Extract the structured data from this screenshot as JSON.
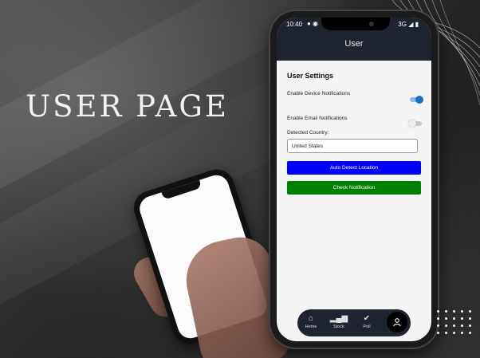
{
  "banner": {
    "headline": "USER PAGE"
  },
  "status_bar": {
    "time": "10:40",
    "network": "3G"
  },
  "app_bar": {
    "title": "User"
  },
  "settings": {
    "section_title": "User Settings",
    "device_notifications": {
      "label": "Enable Device Notifications",
      "enabled": true
    },
    "email_notifications": {
      "label": "Enable Email Notifications",
      "enabled": false
    },
    "country_label": "Detected Country:",
    "country_value": "United States"
  },
  "buttons": {
    "auto_detect_label": "Auto Detect Location",
    "check_notification_label": "Check Notification"
  },
  "bottom_nav": {
    "items": [
      {
        "label": "Home",
        "icon": "home-icon"
      },
      {
        "label": "Stock",
        "icon": "bar-chart-icon"
      },
      {
        "label": "Poll",
        "icon": "check-circle-icon"
      }
    ],
    "active": "user-icon"
  },
  "colors": {
    "app_bar": "#1e2330",
    "primary_button": "#0000ff",
    "secondary_button": "#008000",
    "toggle_on": "#1f6fbf"
  }
}
